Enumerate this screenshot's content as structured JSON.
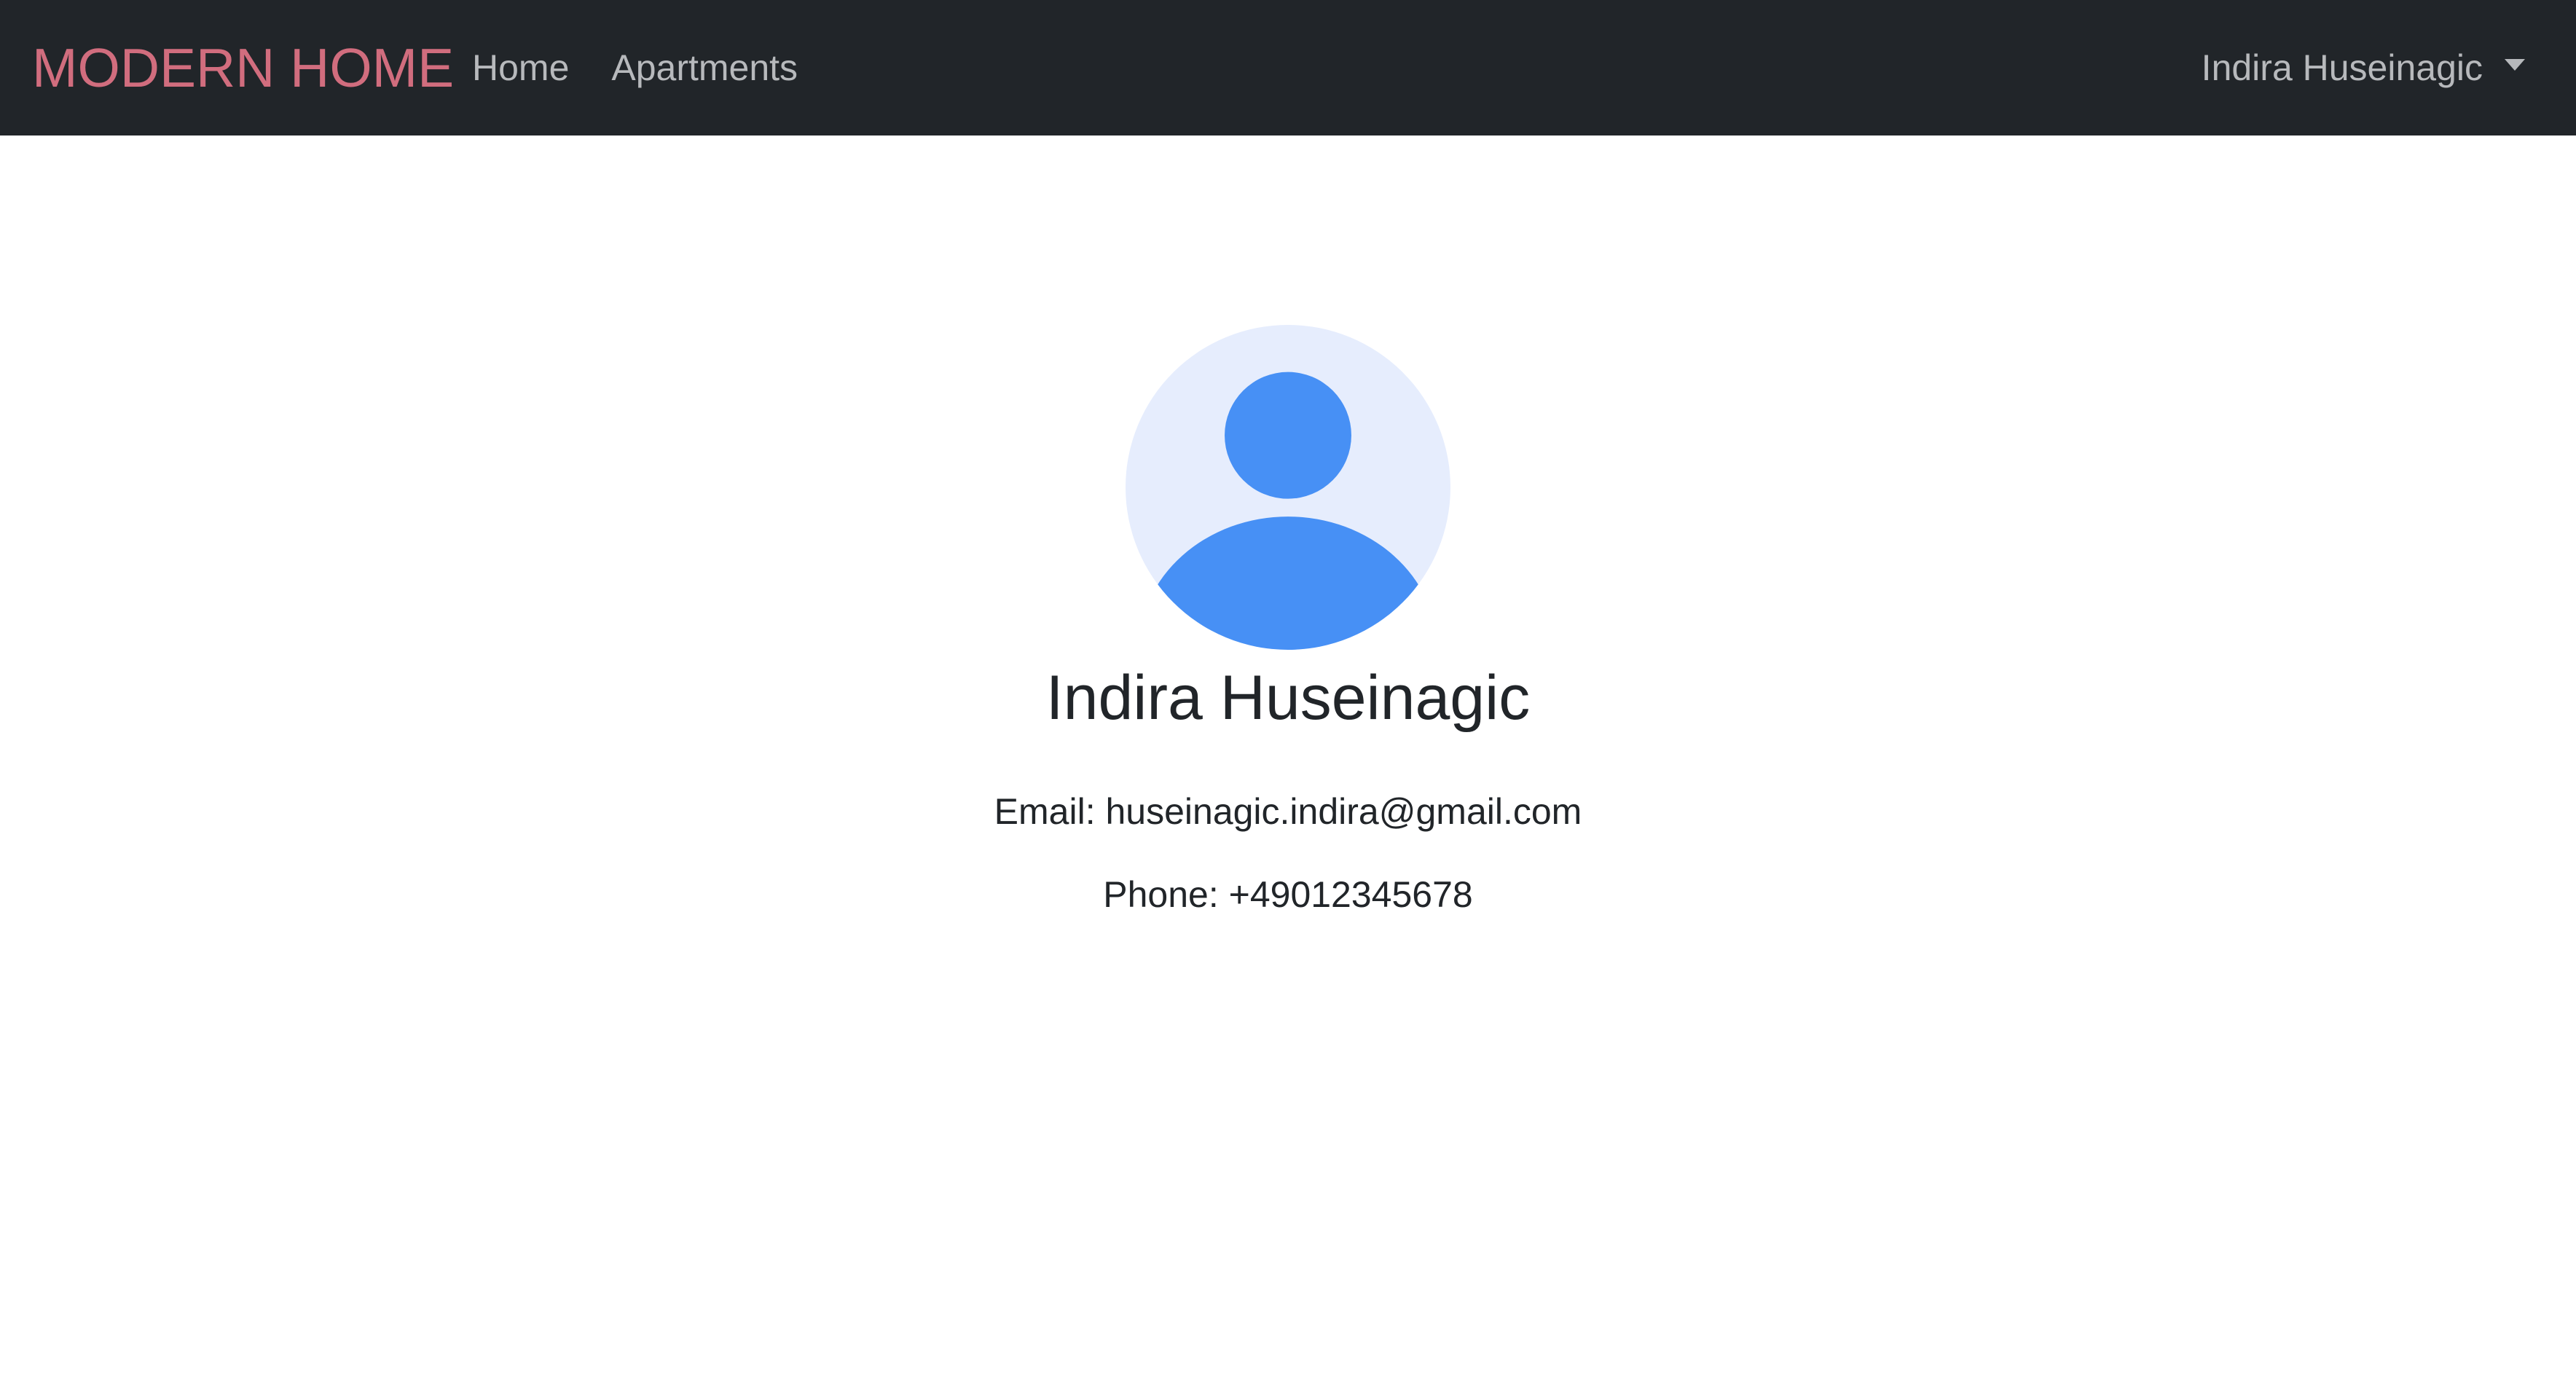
{
  "navbar": {
    "brand": "MODERN HOME",
    "links": [
      {
        "label": "Home"
      },
      {
        "label": "Apartments"
      }
    ],
    "user_menu": {
      "label": "Indira Huseinagic",
      "icon": "chevron-down-icon"
    }
  },
  "profile": {
    "avatar_icon": "user-avatar-icon",
    "name": "Indira Huseinagic",
    "email_line": "Email: huseinagic.indira@gmail.com",
    "phone_line": "Phone: +49012345678"
  },
  "colors": {
    "navbar_bg": "#212529",
    "brand": "#d16d7e",
    "nav_text": "#b7b9bc",
    "avatar_bg": "#e6edfd",
    "avatar_fg": "#4790f5"
  }
}
